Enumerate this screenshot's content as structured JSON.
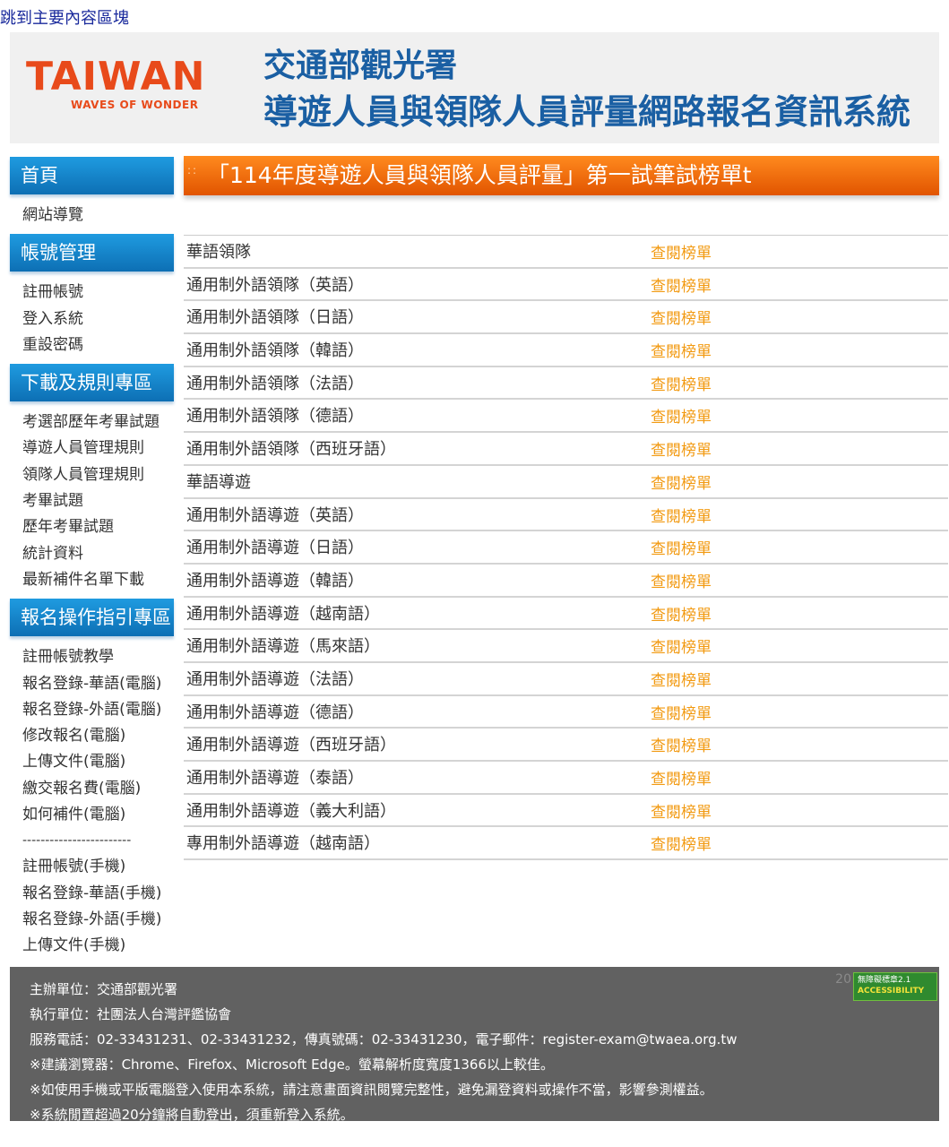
{
  "skip_link": "跳到主要內容區塊",
  "logo": {
    "main": "TAIWAN",
    "tagline": "WAVES OF WONDER"
  },
  "banner": {
    "line1": "交通部觀光署",
    "line2": "導遊人員與領隊人員評量網路報名資訊系統"
  },
  "sidebar": {
    "sections": [
      {
        "title": "首頁",
        "items": [
          "網站導覽"
        ]
      },
      {
        "title": "帳號管理",
        "items": [
          "註冊帳號",
          "登入系統",
          "重設密碼"
        ]
      },
      {
        "title": "下載及規則專區",
        "items": [
          "考選部歷年考畢試題",
          "導遊人員管理規則",
          "領隊人員管理規則",
          "考畢試題",
          "歷年考畢試題",
          "統計資料",
          "最新補件名單下載"
        ]
      },
      {
        "title": "報名操作指引專區",
        "items": [
          "註冊帳號教學",
          "報名登錄-華語(電腦)",
          "報名登錄-外語(電腦)",
          "修改報名(電腦)",
          "上傳文件(電腦)",
          "繳交報名費(電腦)",
          "如何補件(電腦)"
        ],
        "separator": "------------------------",
        "items2": [
          "註冊帳號(手機)",
          "報名登錄-華語(手機)",
          "報名登錄-外語(手機)",
          "上傳文件(手機)"
        ]
      }
    ]
  },
  "main": {
    "heading": "「114年度導遊人員與領隊人員評量」第一試筆試榜單t",
    "link_label": "查閱榜單",
    "rows": [
      "華語領隊",
      "通用制外語領隊（英語）",
      "通用制外語領隊（日語）",
      "通用制外語領隊（韓語）",
      "通用制外語領隊（法語）",
      "通用制外語領隊（德語）",
      "通用制外語領隊（西班牙語）",
      "華語導遊",
      "通用制外語導遊（英語）",
      "通用制外語導遊（日語）",
      "通用制外語導遊（韓語）",
      "通用制外語導遊（越南語）",
      "通用制外語導遊（馬來語）",
      "通用制外語導遊（法語）",
      "通用制外語導遊（德語）",
      "通用制外語導遊（西班牙語）",
      "通用制外語導遊（泰語）",
      "通用制外語導遊（義大利語）",
      "專用制外語導遊（越南語）"
    ]
  },
  "footer": {
    "lines": [
      "主辦單位：交通部觀光署",
      "執行單位：社團法人台灣評鑑協會",
      "服務電話：02-33431231、02-33431232，傳真號碼：02-33431230，電子郵件：register-exam@twaea.org.tw",
      "※建議瀏覽器：Chrome、Firefox、Microsoft Edge。螢幕解析度寬度1366以上較佳。",
      "※如使用手機或平版電腦登入使用本系統，請注意畫面資訊閱覽完整性，避免漏登資料或操作不當，影響參測權益。",
      "※系統閒置超過20分鐘將自動登出，須重新登入系統。"
    ],
    "badge_year": "20",
    "badge_line1": "無障礙標章2.1",
    "badge_line2": "ACCESSIBILITY"
  },
  "colors": {
    "accent_blue": "#1a5fa3",
    "sidebar_blue": "#1f9be0",
    "heading_orange": "#ff8a1e",
    "link_orange": "#f29a12",
    "footer_gray": "#616161"
  }
}
